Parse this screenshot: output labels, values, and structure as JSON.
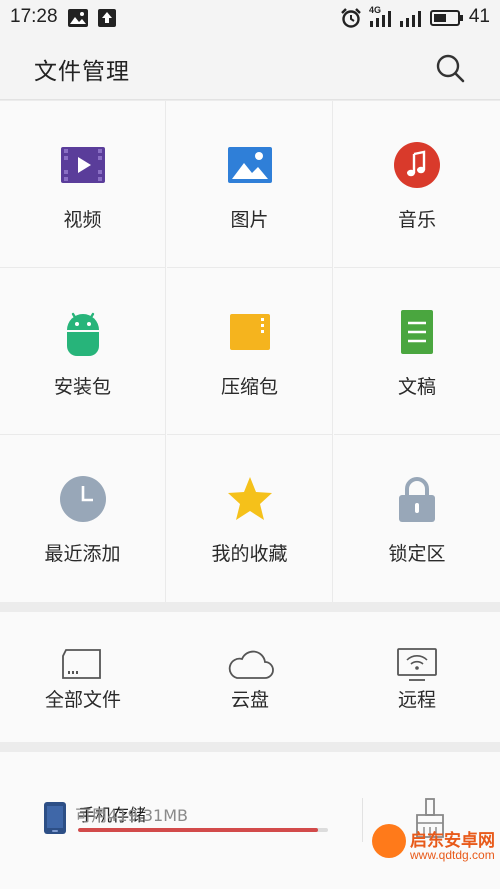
{
  "status_bar": {
    "time": "17:28",
    "network": "4G",
    "battery": "41",
    "icons": [
      "image-icon",
      "upload-icon",
      "alarm-icon",
      "signal-icon",
      "signal-icon",
      "battery-icon"
    ]
  },
  "app_bar": {
    "title": "文件管理",
    "search_icon": "search-icon"
  },
  "categories": [
    {
      "label": "视频",
      "icon": "video-icon",
      "color": "#5a3d9a"
    },
    {
      "label": "图片",
      "icon": "image-icon",
      "color": "#2f7fd8"
    },
    {
      "label": "音乐",
      "icon": "music-icon",
      "color": "#d93a2b"
    },
    {
      "label": "安装包",
      "icon": "android-icon",
      "color": "#27b47a"
    },
    {
      "label": "压缩包",
      "icon": "archive-icon",
      "color": "#f5b41e"
    },
    {
      "label": "文稿",
      "icon": "document-icon",
      "color": "#4aa63f"
    },
    {
      "label": "最近添加",
      "icon": "clock-icon",
      "color": "#98a7b8"
    },
    {
      "label": "我的收藏",
      "icon": "star-icon",
      "color": "#f5c11a"
    },
    {
      "label": "锁定区",
      "icon": "lock-icon",
      "color": "#98a7b8"
    }
  ],
  "quick_access": [
    {
      "label": "全部文件",
      "icon": "sd-card-icon"
    },
    {
      "label": "云盘",
      "icon": "cloud-icon"
    },
    {
      "label": "远程",
      "icon": "remote-screen-icon"
    }
  ],
  "storage": {
    "name": "手机存储",
    "free": "可用419.31MB",
    "used_fraction": 0.96,
    "bar_color": "#d24a4a",
    "icon": "phone-icon",
    "clean_icon": "broom-icon"
  },
  "watermark": {
    "text": "启东安卓网",
    "url": "www.qdtdg.com"
  }
}
